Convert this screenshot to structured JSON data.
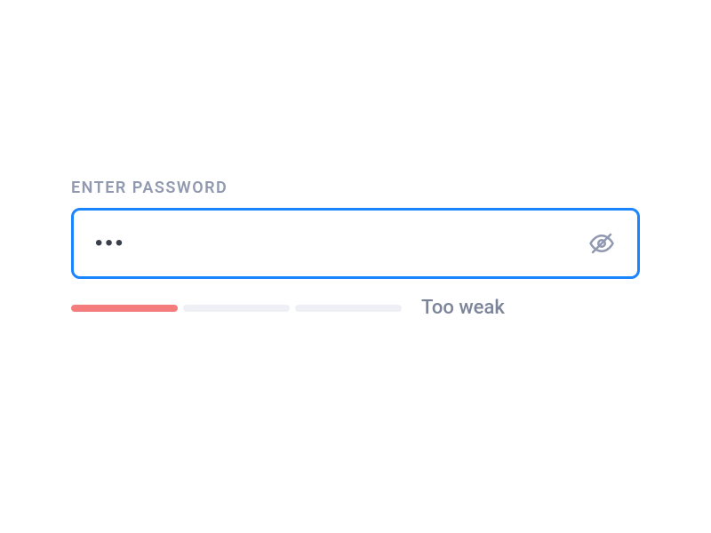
{
  "password": {
    "label": "ENTER PASSWORD",
    "value": "•••",
    "strength_text": "Too weak",
    "strength_level": 1,
    "strength_max": 3
  },
  "colors": {
    "border_focus": "#1a85ff",
    "label_text": "#9099b0",
    "strength_weak": "#f47c7c",
    "strength_empty": "#eef0f5",
    "strength_text": "#7b8499"
  }
}
